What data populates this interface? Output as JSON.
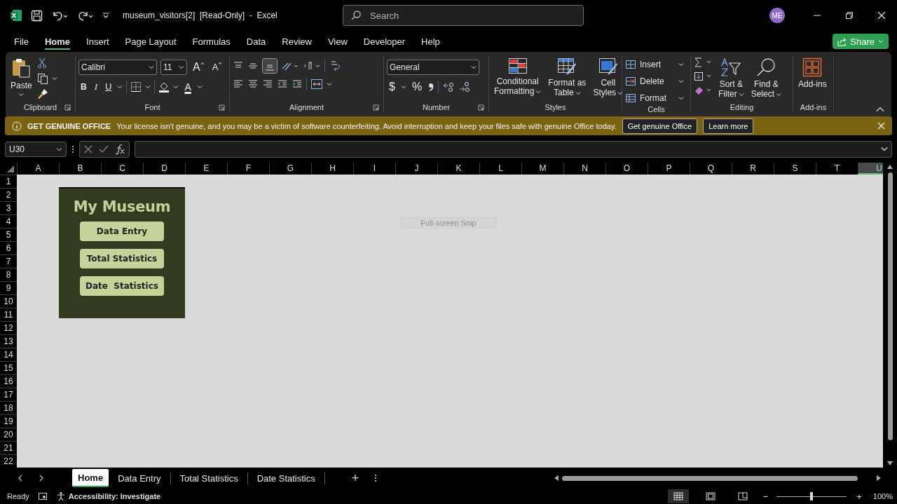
{
  "title_bar": {
    "title": "museum_visitors[2]  [Read-Only]  -  Excel",
    "search": {
      "placeholder": "Search"
    },
    "avatar": "ME"
  },
  "menu_tabs": [
    {
      "label": "File",
      "selected": false
    },
    {
      "label": "Home",
      "selected": true
    },
    {
      "label": "Insert",
      "selected": false
    },
    {
      "label": "Page Layout",
      "selected": false
    },
    {
      "label": "Formulas",
      "selected": false
    },
    {
      "label": "Data",
      "selected": false
    },
    {
      "label": "Review",
      "selected": false
    },
    {
      "label": "View",
      "selected": false
    },
    {
      "label": "Developer",
      "selected": false
    },
    {
      "label": "Help",
      "selected": false
    }
  ],
  "share_button": "Share",
  "ribbon": {
    "clipboard": {
      "label": "Clipboard",
      "paste": "Paste"
    },
    "font": {
      "label": "Font",
      "font_name": "Calibri",
      "font_size": "11",
      "grow": "A",
      "shrink": "A",
      "bold": "B",
      "italic": "I",
      "underline": "U",
      "font_color": "A"
    },
    "alignment": {
      "label": "Alignment",
      "bottom_align_selected": true
    },
    "number": {
      "label": "Number",
      "format": "General",
      "currency": "$",
      "percent": "%"
    },
    "styles": {
      "label": "Styles",
      "buttons": [
        {
          "kind": "conditional",
          "lines": [
            "Conditional",
            "Formatting"
          ]
        },
        {
          "kind": "table",
          "lines": [
            "Format as",
            "Table"
          ]
        },
        {
          "kind": "cellstyles",
          "lines": [
            "Cell",
            "Styles"
          ]
        }
      ]
    },
    "cells": {
      "label": "Cells",
      "buttons": [
        {
          "kind": "insert",
          "label": "Insert"
        },
        {
          "kind": "delete",
          "label": "Delete"
        },
        {
          "kind": "format",
          "label": "Format"
        }
      ]
    },
    "editing": {
      "label": "Editing",
      "buttons": [
        {
          "kind": "sort",
          "lines": [
            "Sort &",
            "Filter"
          ]
        },
        {
          "kind": "find",
          "lines": [
            "Find &",
            "Select"
          ]
        }
      ]
    },
    "addins": {
      "label": "Add-ins",
      "button": "Add-ins"
    }
  },
  "notification": {
    "title": "GET GENUINE OFFICE",
    "message": "Your license isn't genuine, and you may be a victim of software counterfeiting. Avoid interruption and keep your files safe with genuine Office today.",
    "buttons": [
      "Get genuine Office",
      "Learn more"
    ]
  },
  "formula_bar": {
    "name_box": "U30"
  },
  "columns": [
    {
      "label": "A",
      "selected": false
    },
    {
      "label": "B",
      "selected": false
    },
    {
      "label": "C",
      "selected": false
    },
    {
      "label": "D",
      "selected": false
    },
    {
      "label": "E",
      "selected": false
    },
    {
      "label": "F",
      "selected": false
    },
    {
      "label": "G",
      "selected": false
    },
    {
      "label": "H",
      "selected": false
    },
    {
      "label": "I",
      "selected": false
    },
    {
      "label": "J",
      "selected": false
    },
    {
      "label": "K",
      "selected": false
    },
    {
      "label": "L",
      "selected": false
    },
    {
      "label": "M",
      "selected": false
    },
    {
      "label": "N",
      "selected": false
    },
    {
      "label": "O",
      "selected": false
    },
    {
      "label": "P",
      "selected": false
    },
    {
      "label": "Q",
      "selected": false
    },
    {
      "label": "R",
      "selected": false
    },
    {
      "label": "S",
      "selected": false
    },
    {
      "label": "T",
      "selected": false
    },
    {
      "label": "U",
      "selected": true
    }
  ],
  "rows": [
    "1",
    "2",
    "3",
    "4",
    "5",
    "6",
    "7",
    "8",
    "9",
    "10",
    "11",
    "12",
    "13",
    "14",
    "15",
    "16",
    "17",
    "18",
    "19",
    "20",
    "21",
    "22"
  ],
  "panel": {
    "title": "My Museum",
    "buttons": [
      "Data Entry",
      "Total Statistics",
      "Date  Statistics"
    ]
  },
  "snip_hint": "Full-screen Snip",
  "sheet_tabs": [
    {
      "label": "Home",
      "selected": true
    },
    {
      "label": "Data Entry",
      "selected": false
    },
    {
      "label": "Total Statistics",
      "selected": false
    },
    {
      "label": "Date Statistics",
      "selected": false
    }
  ],
  "new_sheet": "+",
  "status_bar": {
    "mode": "Ready",
    "accessibility": "Accessibility: Investigate",
    "views": [
      {
        "kind": "normal",
        "selected": true
      },
      {
        "kind": "page_layout",
        "selected": false
      },
      {
        "kind": "page_break",
        "selected": false
      }
    ],
    "zoom_out": "−",
    "zoom_in": "+",
    "zoom": {
      "level": 0.5
    },
    "zoom_text": "100%"
  }
}
